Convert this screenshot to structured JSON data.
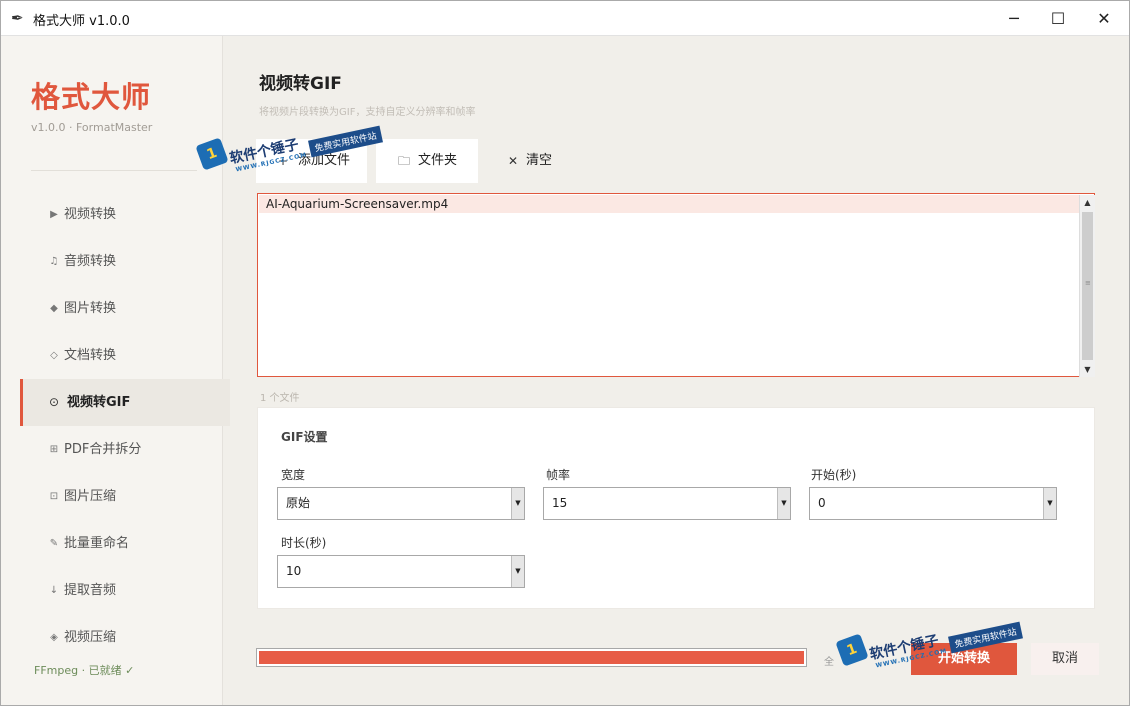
{
  "window": {
    "title": "格式大师 v1.0.0",
    "app_icon": "feather-icon",
    "controls": {
      "minimize": "─",
      "maximize": "☐",
      "close": "✕"
    }
  },
  "sidebar": {
    "brand": "格式大师",
    "version": "v1.0.0 · FormatMaster",
    "items": [
      {
        "icon": "▶",
        "icon_name": "play-icon",
        "label": "视频转换"
      },
      {
        "icon": "♫",
        "icon_name": "music-note-icon",
        "label": "音频转换"
      },
      {
        "icon": "◆",
        "icon_name": "diamond-icon",
        "label": "图片转换"
      },
      {
        "icon": "◇",
        "icon_name": "diamond-outline-icon",
        "label": "文档转换"
      },
      {
        "icon": "⊙",
        "icon_name": "target-icon",
        "label": "视频转GIF",
        "active": true
      },
      {
        "icon": "⊞",
        "icon_name": "grid-icon",
        "label": "PDF合并拆分"
      },
      {
        "icon": "⊡",
        "icon_name": "square-icon",
        "label": "图片压缩"
      },
      {
        "icon": "✎",
        "icon_name": "pencil-icon",
        "label": "批量重命名"
      },
      {
        "icon": "↓",
        "icon_name": "arrow-down-icon",
        "label": "提取音频"
      },
      {
        "icon": "◈",
        "icon_name": "compress-icon",
        "label": "视频压缩"
      }
    ],
    "status": "FFmpeg · 已就绪 ✓"
  },
  "main": {
    "title": "视频转GIF",
    "subtitle": "将视频片段转换为GIF，支持自定义分辨率和帧率",
    "toolbar": {
      "add_files": {
        "icon": "+",
        "label": "添加文件"
      },
      "folder": {
        "icon": "🗀",
        "label": "文件夹"
      },
      "clear": {
        "icon": "✕",
        "label": "清空"
      }
    },
    "files": [
      "AI-Aquarium-Screensaver.mp4"
    ],
    "file_count": "1 个文件",
    "settings": {
      "title": "GIF设置",
      "fields": {
        "width": {
          "label": "宽度",
          "value": "原始"
        },
        "fps": {
          "label": "帧率",
          "value": "15"
        },
        "start": {
          "label": "开始(秒)",
          "value": "0"
        },
        "duration": {
          "label": "时长(秒)",
          "value": "10"
        }
      }
    },
    "progress": {
      "fraction": 1.0,
      "text": "全"
    },
    "start_button": "开始转换",
    "cancel_button": "取消"
  },
  "watermark": {
    "name": "软件个锤子",
    "url": "WWW.RJGCZ.COM",
    "tag": "免费实用软件站",
    "logo": "1"
  },
  "colors": {
    "accent": "#e0573d",
    "progress": "#e75c46",
    "status_ok": "#6d8c5a"
  }
}
